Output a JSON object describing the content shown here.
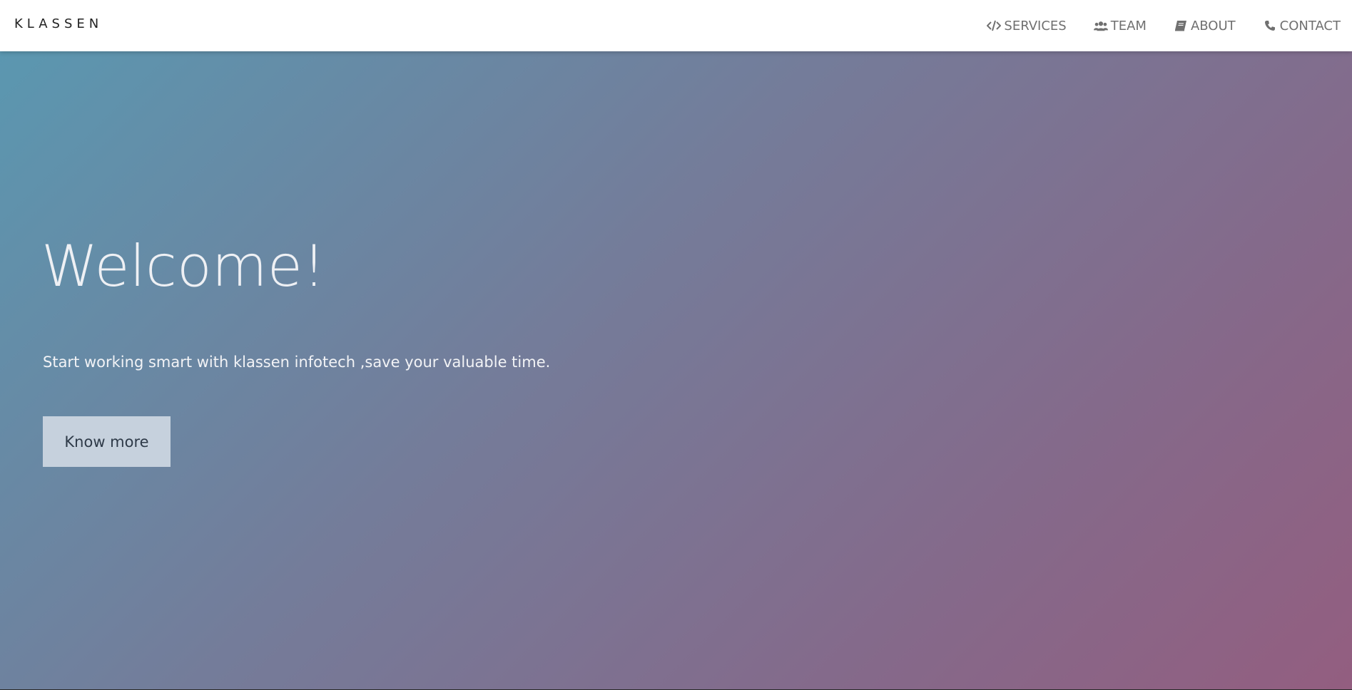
{
  "brand": "KLASSEN",
  "nav": {
    "items": [
      {
        "label": "SERVICES",
        "icon": "code-icon"
      },
      {
        "label": "TEAM",
        "icon": "users-icon"
      },
      {
        "label": "ABOUT",
        "icon": "book-icon"
      },
      {
        "label": "CONTACT",
        "icon": "phone-icon"
      }
    ]
  },
  "hero": {
    "title": "Welcome!",
    "subtitle": "Start working smart with klassen infotech ,save your valuable time.",
    "button_label": "Know more"
  },
  "colors": {
    "gradient_start": "#5b97b0",
    "gradient_mid": "#767a98",
    "gradient_end": "#935e80",
    "button_bg": "#c6d1dd",
    "nav_text": "#707070"
  }
}
